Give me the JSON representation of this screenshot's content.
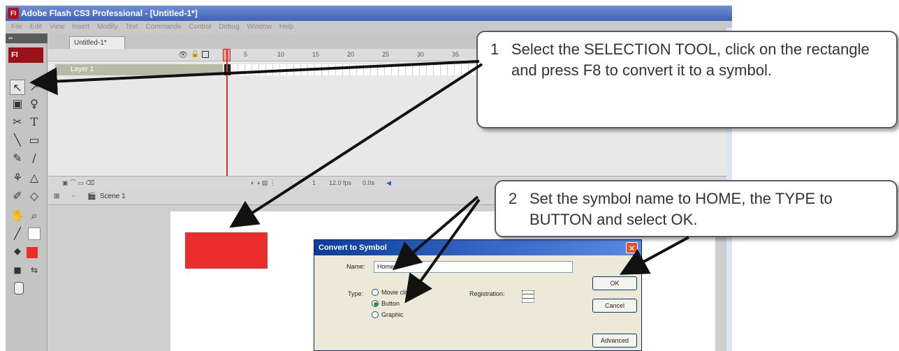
{
  "window": {
    "title": "Adobe Flash CS3 Professional - [Untitled-1*]",
    "app_icon": "Fl",
    "menu": [
      "File",
      "Edit",
      "View",
      "Insert",
      "Modify",
      "Text",
      "Commands",
      "Control",
      "Debug",
      "Window",
      "Help"
    ]
  },
  "toolbox": {
    "logo": "Fl",
    "tools": [
      {
        "name": "selection-tool",
        "glyph": "↖",
        "selected": true
      },
      {
        "name": "subselection-tool",
        "glyph": "↗"
      },
      {
        "name": "free-transform-tool",
        "glyph": "▣"
      },
      {
        "name": "lasso-tool",
        "glyph": "♀"
      },
      {
        "name": "pen-tool",
        "glyph": "✂"
      },
      {
        "name": "text-tool",
        "glyph": "T"
      },
      {
        "name": "line-tool",
        "glyph": "╲"
      },
      {
        "name": "rectangle-tool",
        "glyph": "▭"
      },
      {
        "name": "pencil-tool",
        "glyph": "✎"
      },
      {
        "name": "brush-tool",
        "glyph": "∕"
      },
      {
        "name": "ink-bottle-tool",
        "glyph": "⚘"
      },
      {
        "name": "paint-bucket-tool",
        "glyph": "△"
      },
      {
        "name": "eyedropper-tool",
        "glyph": "✐"
      },
      {
        "name": "eraser-tool",
        "glyph": "◇"
      },
      {
        "name": "hand-tool",
        "glyph": "✋"
      },
      {
        "name": "zoom-tool",
        "glyph": "⌕"
      },
      {
        "name": "stroke-color-tool",
        "glyph": "╱"
      },
      {
        "name": "fill-color-tool",
        "glyph": "╱"
      }
    ]
  },
  "document": {
    "tab_label": "Untitled-1*",
    "layer_name": "Layer 1",
    "frame_numbers": [
      "5",
      "10",
      "15",
      "20",
      "25",
      "30",
      "35"
    ],
    "timeline_status": {
      "frame": "1",
      "fps": "12.0 fps",
      "time": "0.0s"
    },
    "scene_label": "Scene 1"
  },
  "dialog": {
    "title": "Convert to Symbol",
    "name_label": "Name:",
    "name_value": "Home",
    "type_label": "Type:",
    "types": [
      "Movie clip",
      "Button",
      "Graphic"
    ],
    "selected_type": "Button",
    "registration_label": "Registration:",
    "ok_label": "OK",
    "cancel_label": "Cancel",
    "advanced_label": "Advanced"
  },
  "callouts": [
    {
      "number": "1",
      "text": "Select the SELECTION TOOL, click on the rectangle and press F8 to convert it to a symbol."
    },
    {
      "number": "2",
      "text": "Set the symbol name to HOME, the TYPE to BUTTON and select OK."
    }
  ],
  "colors": {
    "rectangle": "#ea2d2d",
    "arrow": "#111111",
    "flash_red": "#9b1119"
  }
}
